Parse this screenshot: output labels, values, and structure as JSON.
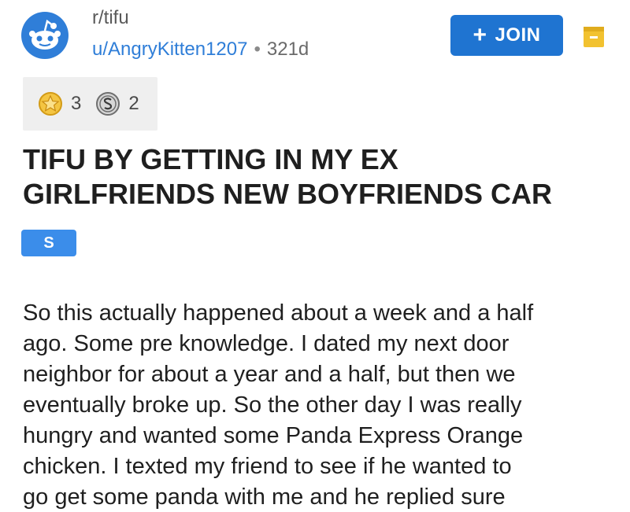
{
  "post": {
    "subreddit": "r/tifu",
    "author": "u/AngryKitten1207",
    "separator": "•",
    "age": "321d",
    "join_label": "JOIN",
    "join_plus": "+",
    "awards": [
      {
        "icon": "gold-star-award-icon",
        "count": "3"
      },
      {
        "icon": "silver-award-icon",
        "count": "2"
      }
    ],
    "title_line1": "TIFU BY GETTING IN MY EX",
    "title_line2": "GIRLFRIENDS NEW BOYFRIENDS CAR",
    "flair": "S",
    "body": "So this actually happened about a week and a half\nago. Some pre knowledge. I dated my next door\nneighbor for about a year and a half, but then we\neventually broke up. So the other day I was really\nhungry and wanted some Panda Express Orange\nchicken. I texted my friend to see if he wanted to\ngo get some panda with me and he replied sure"
  },
  "colors": {
    "accent_blue": "#1f74d1",
    "author_blue": "#2f7ed8",
    "flair_blue": "#3b8dea",
    "save_yellow": "#f2c230",
    "award_gold": "#f4c542",
    "award_silver": "#c9c9c9"
  }
}
